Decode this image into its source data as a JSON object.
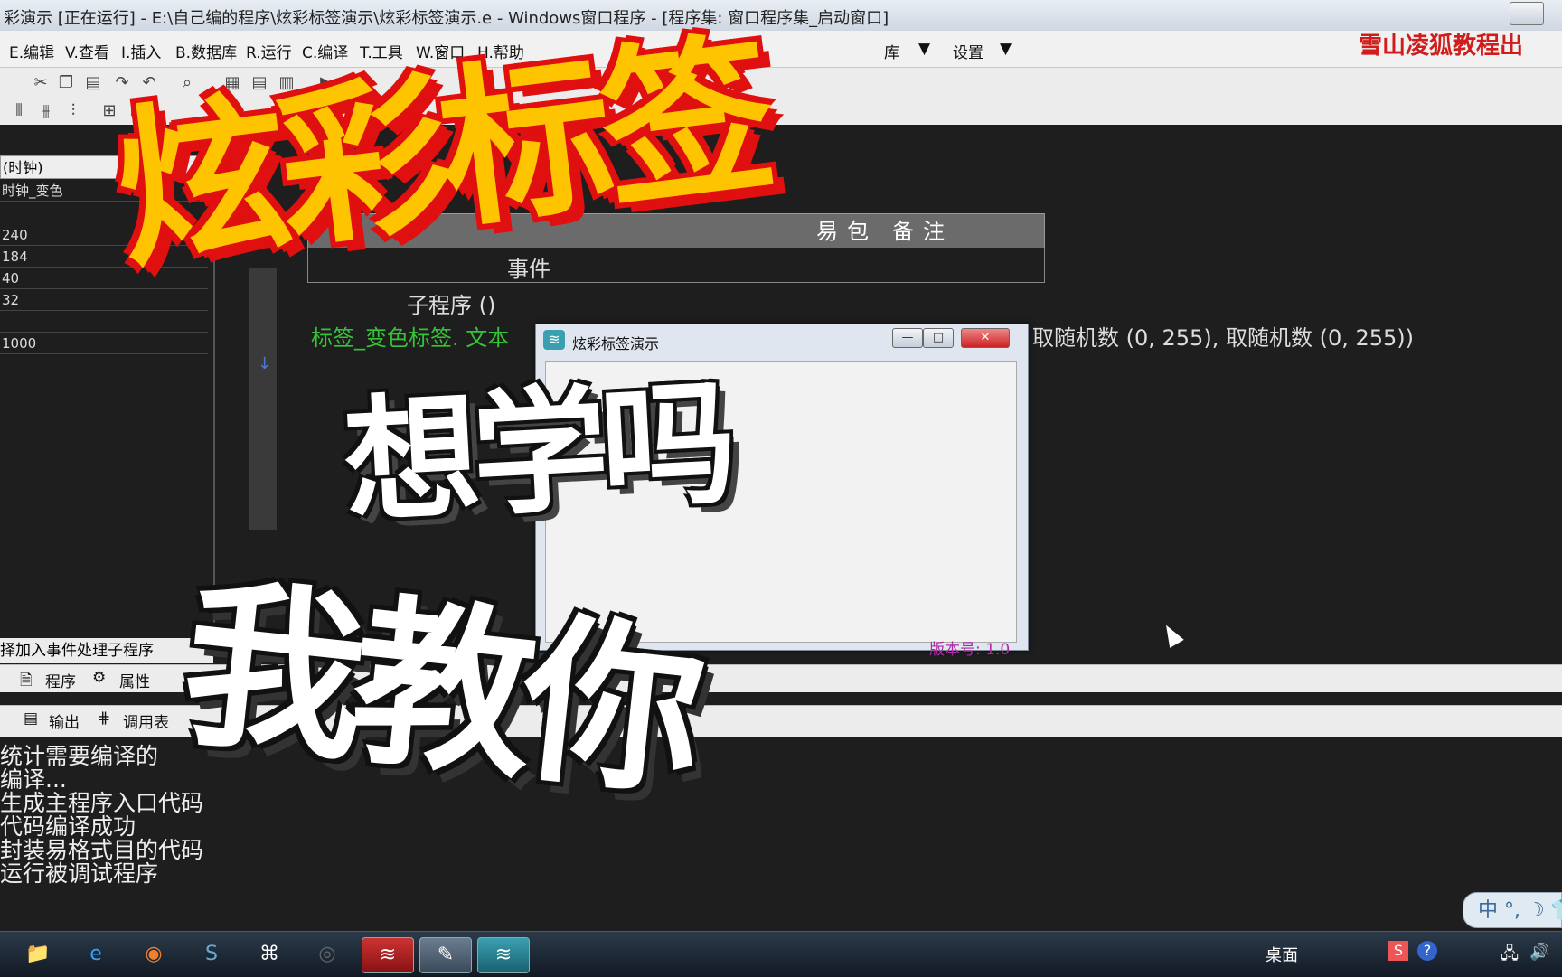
{
  "window": {
    "title": "彩演示 [正在运行] - E:\\自己编的程序\\炫彩标签演示\\炫彩标签演示.e - Windows窗口程序 - [程序集: 窗口程序集_启动窗口]"
  },
  "menu": {
    "items": [
      "E.编辑",
      "V.查看",
      "I.插入",
      "B.数据库",
      "R.运行",
      "C.编译",
      "T.工具",
      "W.窗口",
      "H.帮助"
    ],
    "right_items": [
      "库",
      "设置"
    ],
    "brand": "雪山凌狐教程出"
  },
  "left_panel": {
    "combo_value": "(时钟)",
    "name_value": "时钟_变色",
    "values": [
      "240",
      "184",
      "40",
      "32",
      "",
      "1000"
    ],
    "event_hint": "择加入事件处理子程序",
    "tabs": [
      "程序",
      "属性"
    ]
  },
  "code": {
    "table_headers": [
      "易包",
      "备注"
    ],
    "table_cell": "事件",
    "line1": "子程序 ()",
    "line2": "标签_变色标签. 文本",
    "line2_tail": "取随机数 (0, 255), 取随机数 (0, 255))"
  },
  "dialog": {
    "title": "炫彩标签演示",
    "version": "版本号: 1.0"
  },
  "bottom": {
    "tabs": [
      "输出",
      "调用表"
    ],
    "output_lines": [
      "统计需要编译的",
      "编译...",
      "生成主程序入口代码",
      "代码编译成功",
      "封装易格式目的代码",
      "运行被调试程序"
    ]
  },
  "ime": {
    "text": "中 °, ☽ 👕"
  },
  "taskbar": {
    "tray_desktop": "桌面"
  },
  "overlay": {
    "headline": "炫彩标签",
    "line2": "想学吗",
    "line3": "我教你",
    "colors": {
      "headline": "#ffc400",
      "headline_outline": "#e01010"
    }
  }
}
